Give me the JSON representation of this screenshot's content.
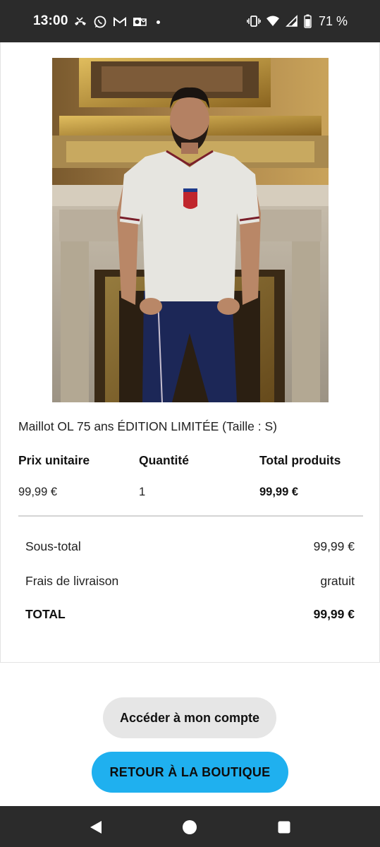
{
  "status_bar": {
    "time": "13:00",
    "left_icons": [
      "missed-call-icon",
      "whatsapp-icon",
      "gmail-icon",
      "outlook-icon",
      "notification-dot-icon"
    ],
    "right_icons": [
      "vibrate-icon",
      "wifi-icon",
      "signal-icon",
      "battery-icon"
    ],
    "battery": "71 %"
  },
  "order": {
    "product": {
      "image": "product-photo-jersey",
      "name": "Maillot OL 75 ans ÉDITION LIMITÉE (Taille : S)"
    },
    "table": {
      "headers": [
        "Prix unitaire",
        "Quantité",
        "Total produits"
      ],
      "row": [
        "99,99 €",
        "1",
        "99,99 €"
      ]
    },
    "summary": {
      "subtotal_label": "Sous-total",
      "subtotal_value": "99,99 €",
      "shipping_label": "Frais de livraison",
      "shipping_value": "gratuit",
      "total_label": "TOTAL",
      "total_value": "99,99 €"
    }
  },
  "actions": {
    "account_label": "Accéder à mon compte",
    "shop_label": "RETOUR À LA BOUTIQUE"
  },
  "colors": {
    "system_bar": "#2b2b2b",
    "primary_button": "#1fb0ef",
    "secondary_button": "#e6e6e6"
  },
  "nav_bar": {
    "icons": [
      "back-icon",
      "home-icon",
      "recents-icon"
    ]
  }
}
